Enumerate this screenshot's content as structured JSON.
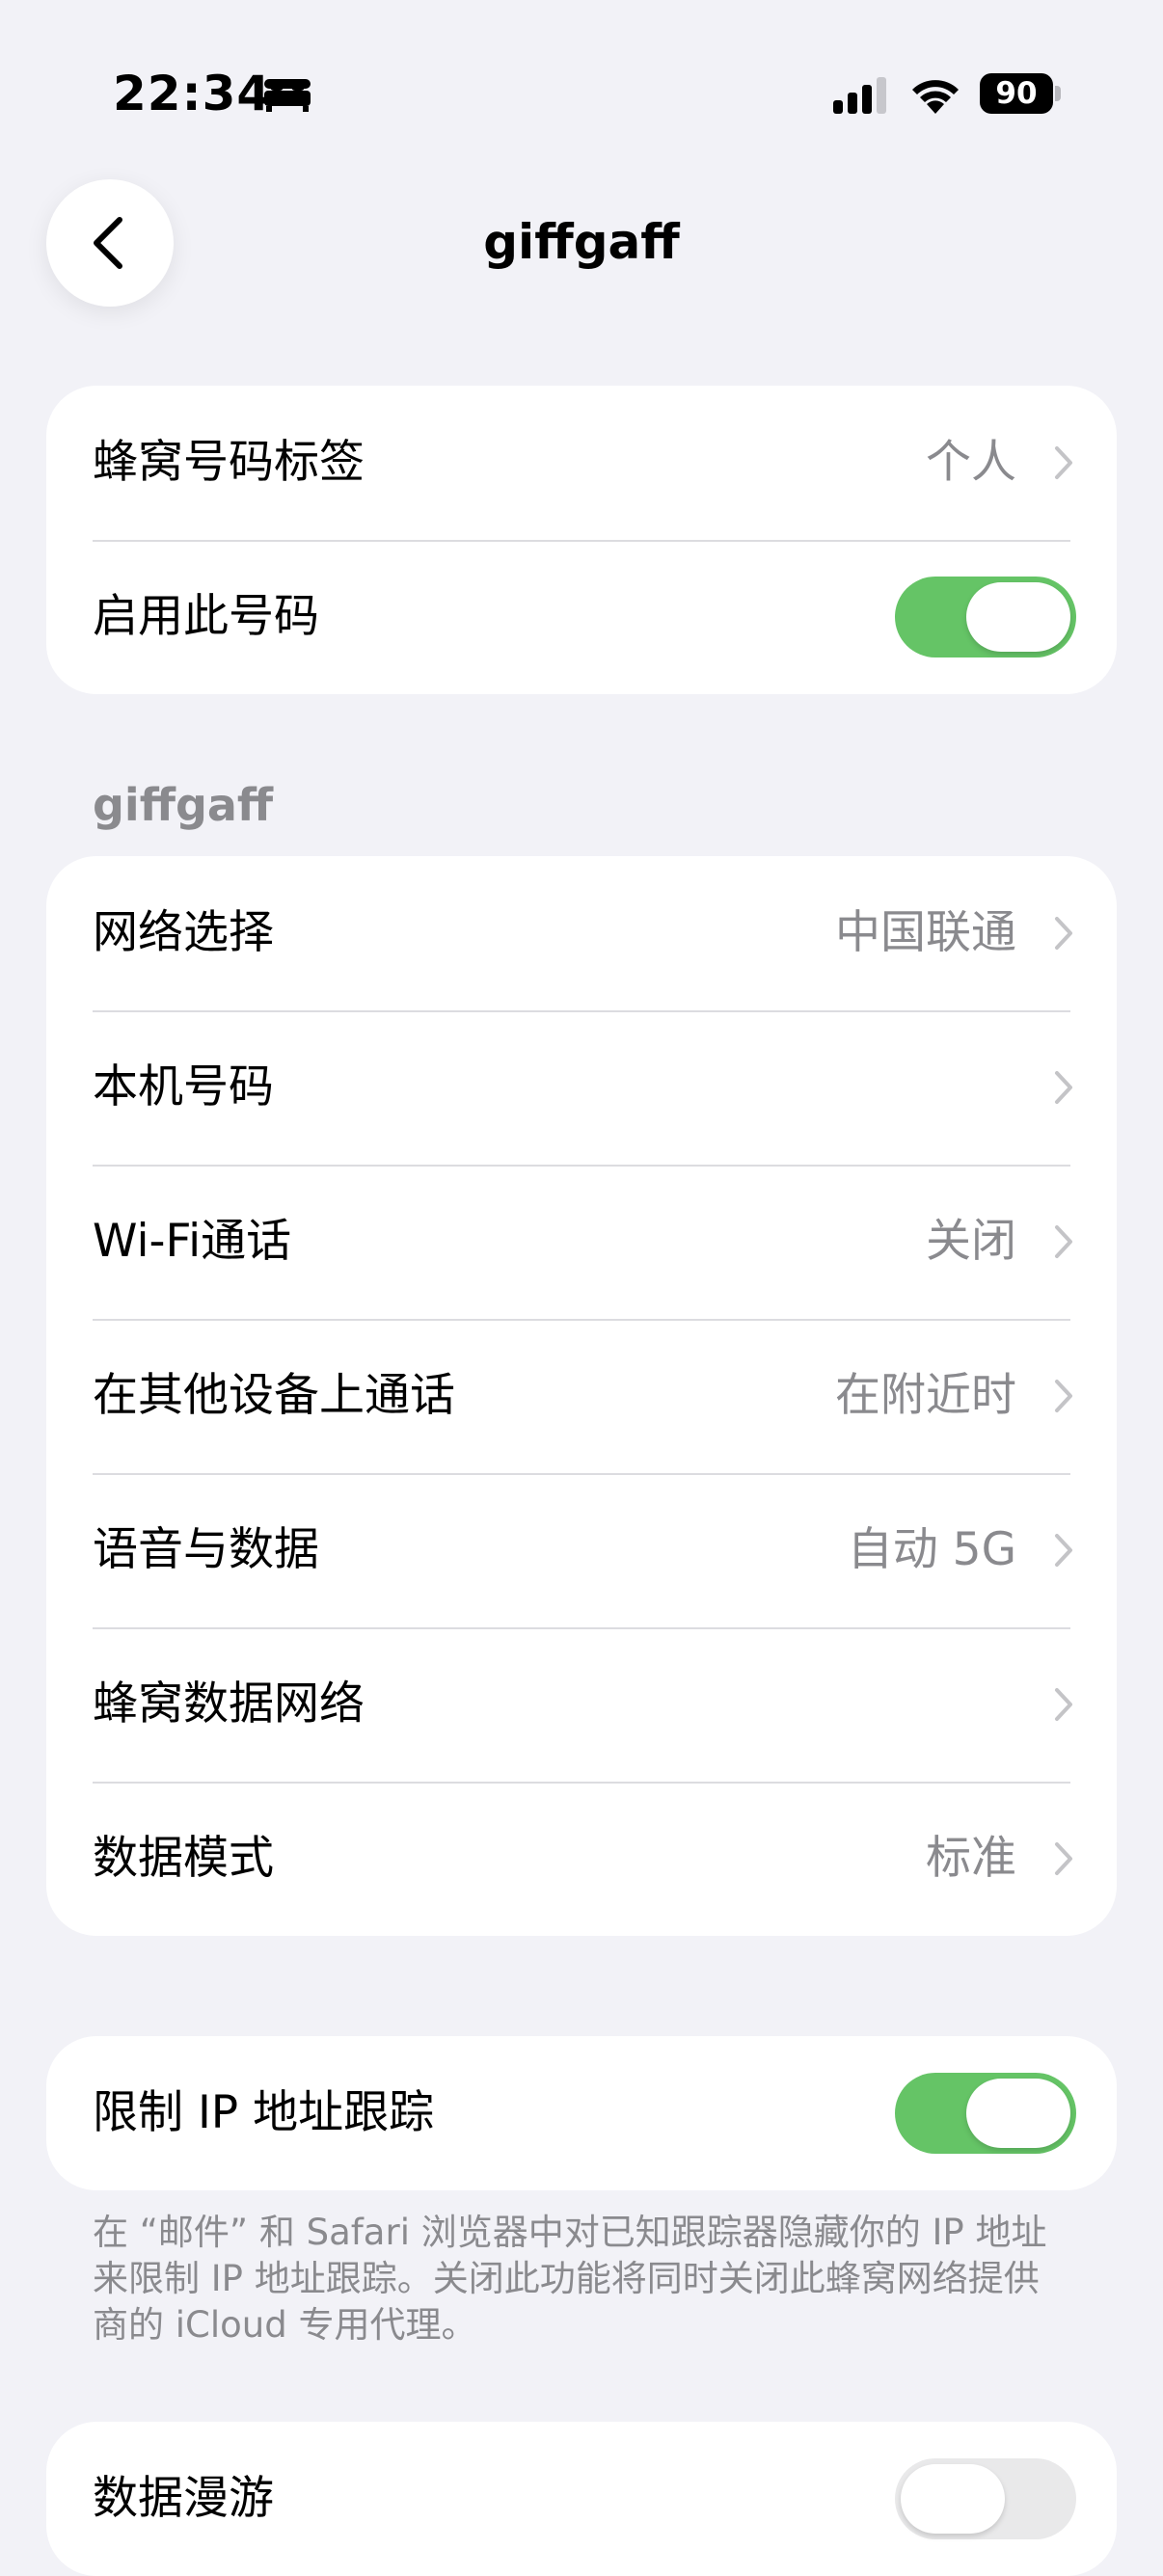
{
  "status_bar": {
    "time": "22:34",
    "battery": "90",
    "icons": [
      "bed-icon",
      "cellular-signal-icon",
      "wifi-icon",
      "battery-icon"
    ]
  },
  "nav": {
    "title": "giffgaff",
    "back_icon": "chevron-left-icon"
  },
  "colors": {
    "background": "#f2f2f7",
    "toggle_on": "#65c466",
    "toggle_off": "#e9e9ea",
    "secondary_text": "#8a8a8e"
  },
  "group1": {
    "label_row": {
      "label": "蜂窝号码标签",
      "value": "个人"
    },
    "enable_row": {
      "label": "启用此号码",
      "toggle": true
    }
  },
  "section_title": "giffgaff",
  "group2": {
    "rows": [
      {
        "label": "网络选择",
        "value": "中国联通"
      },
      {
        "label": "本机号码",
        "value": ""
      },
      {
        "label": "Wi-Fi通话",
        "value": "关闭"
      },
      {
        "label": "在其他设备上通话",
        "value": "在附近时"
      },
      {
        "label": "语音与数据",
        "value": "自动 5G"
      },
      {
        "label": "蜂窝数据网络",
        "value": ""
      },
      {
        "label": "数据模式",
        "value": "标准"
      }
    ]
  },
  "group3": {
    "label": "限制 IP 地址跟踪",
    "toggle": true,
    "footer": "在 “邮件” 和 Safari 浏览器中对已知跟踪器隐藏你的 IP 地址来限制 IP 地址跟踪。关闭此功能将同时关闭此蜂窝网络提供商的 iCloud 专用代理。"
  },
  "group4": {
    "label": "数据漫游",
    "toggle": false
  }
}
